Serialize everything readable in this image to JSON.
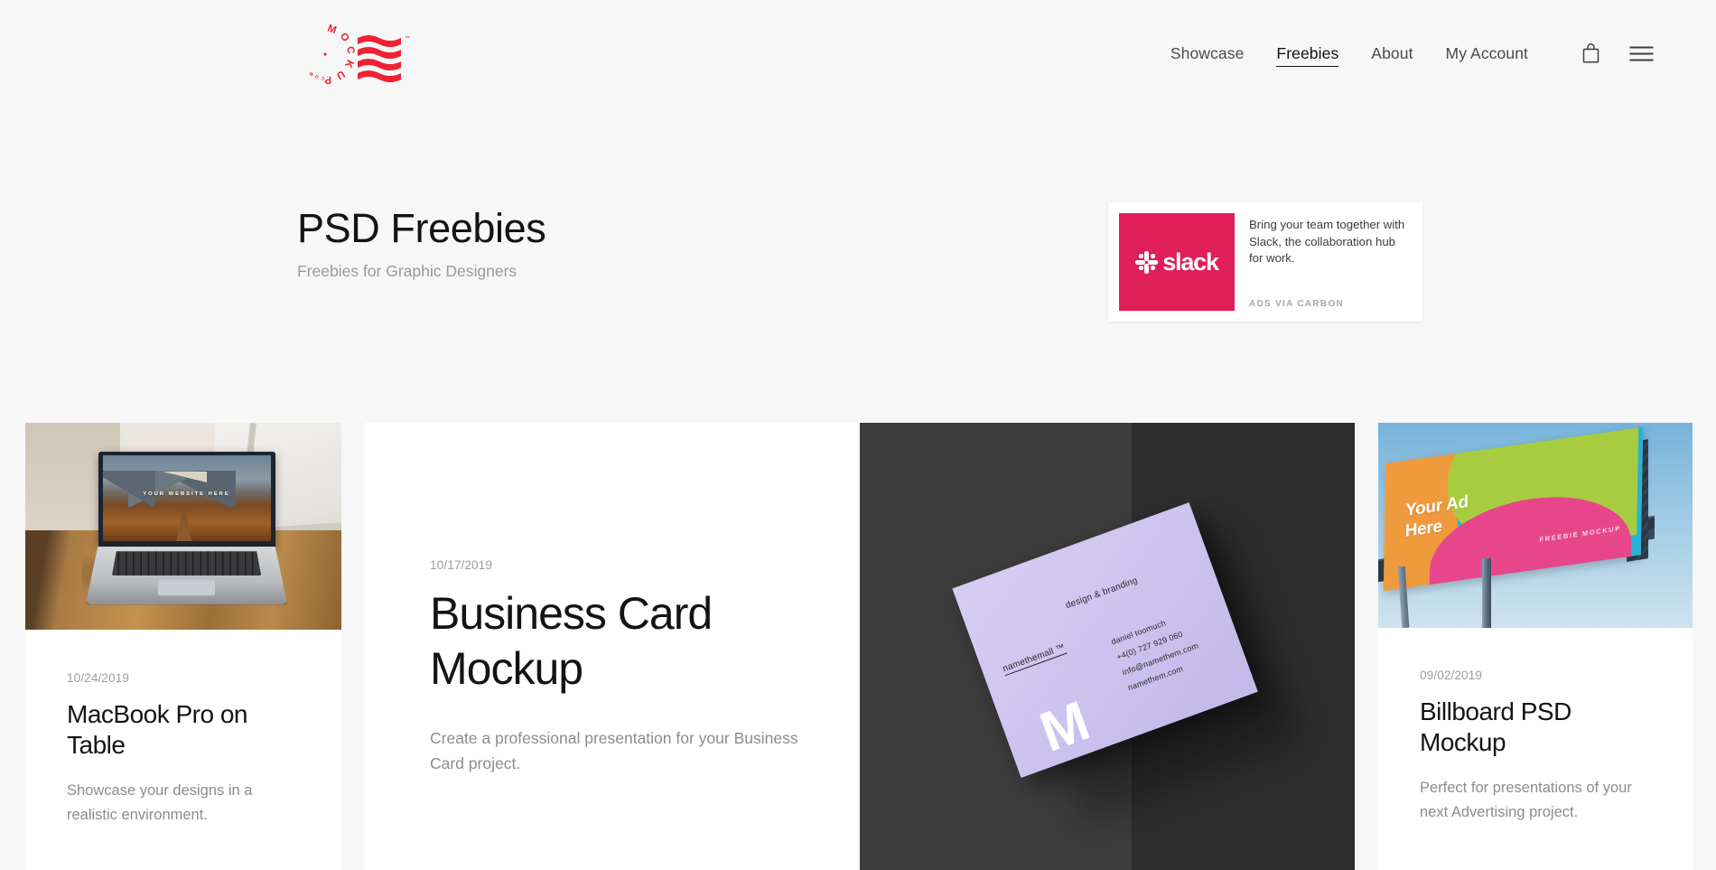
{
  "header": {
    "logo": {
      "name": "mockup-logo",
      "circle_text": "MOCKUP",
      "trademark": "™",
      "color": "#ee2233"
    },
    "nav": [
      {
        "label": "Showcase",
        "active": false
      },
      {
        "label": "Freebies",
        "active": true
      },
      {
        "label": "About",
        "active": false
      },
      {
        "label": "My Account",
        "active": false
      }
    ],
    "icons": [
      {
        "name": "shopping-bag-icon"
      },
      {
        "name": "hamburger-menu-icon"
      }
    ]
  },
  "hero": {
    "title": "PSD Freebies",
    "subtitle": "Freebies for Graphic Designers"
  },
  "ad": {
    "brand": "slack",
    "text": "Bring your team together with Slack, the collaboration hub for work.",
    "via": "ADS VIA CARBON",
    "brand_color": "#e01e5a"
  },
  "cards": [
    {
      "id": "macbook-pro-on-table",
      "date": "10/24/2019",
      "title": "MacBook Pro on Table",
      "excerpt": "Showcase your designs in a realistic environment.",
      "media": {
        "kind": "photo",
        "subject": "MacBook Pro open on a rustic wooden table by a window",
        "screen_text": "YOUR WEBSITE HERE"
      }
    },
    {
      "id": "business-card-mockup",
      "date": "10/17/2019",
      "title": "Business Card Mockup",
      "excerpt": "Create a professional presentation for your Business Card project.",
      "media": {
        "kind": "none"
      }
    },
    {
      "id": "business-card-photo",
      "media": {
        "kind": "photo",
        "subject": "Lavender business card angled on a dark grey背景",
        "card": {
          "brand": "namethemall ™",
          "tagline": "design & branding",
          "name": "daniel toomuch",
          "phone": "+4(0) 727 929 060",
          "email": "info@namethem.com",
          "website": "namethem.com",
          "monogram": "M"
        }
      }
    },
    {
      "id": "billboard-psd-mockup",
      "date": "09/02/2019",
      "title": "Billboard PSD Mockup",
      "excerpt": "Perfect for presentations of your next Advertising project.",
      "media": {
        "kind": "photo",
        "subject": "Colourful billboard against a blue sky",
        "headline_line1": "Your Ad",
        "headline_line2": "Here",
        "watermark": "FREEBIE MOCKUP"
      }
    }
  ],
  "theme": {
    "page_background": "#f7f7f7",
    "card_background": "#ffffff",
    "text_primary": "#141414",
    "text_muted": "#8c8c8c"
  }
}
